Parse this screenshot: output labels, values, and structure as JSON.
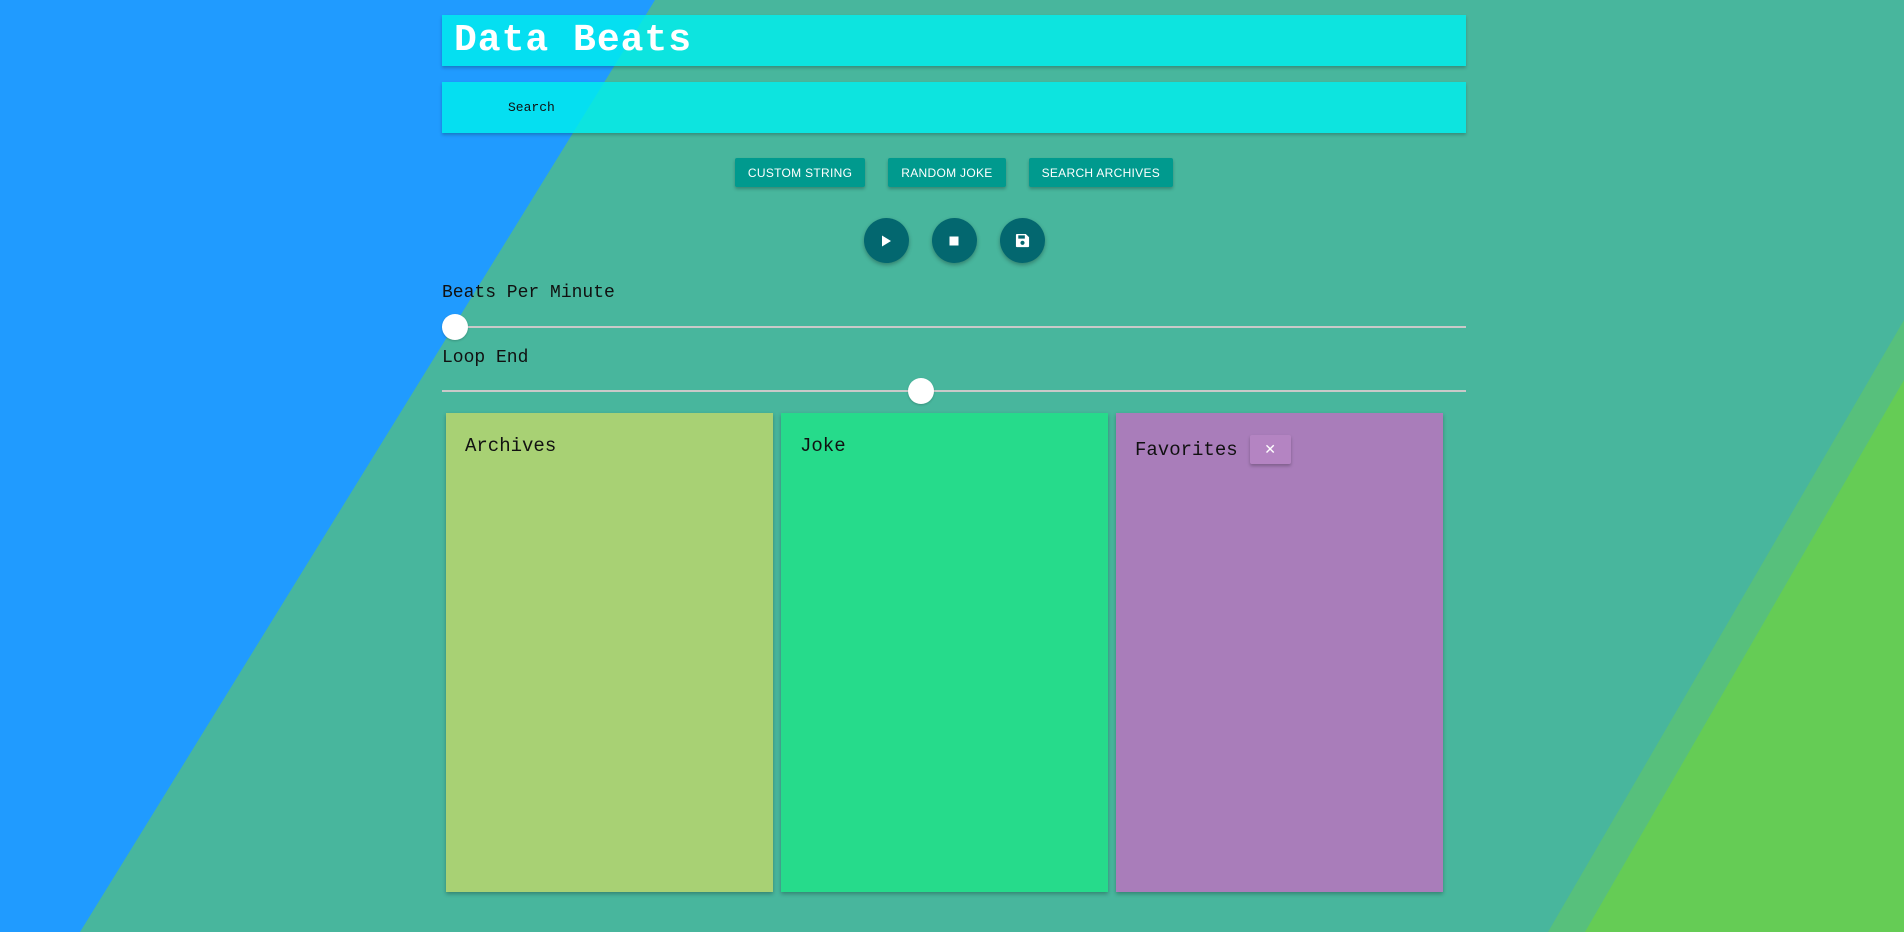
{
  "header": {
    "title": "Data Beats"
  },
  "search": {
    "placeholder": "Search",
    "value": ""
  },
  "actions": {
    "custom_string": "Custom String",
    "random_joke": "Random Joke",
    "search_archives": "Search Archives"
  },
  "transport": {
    "play_icon": "play-icon",
    "stop_icon": "stop-icon",
    "save_icon": "save-icon"
  },
  "sliders": {
    "bpm": {
      "label": "Beats Per Minute",
      "value_fraction": 0.0
    },
    "loop_end": {
      "label": "Loop End",
      "value_fraction": 0.467
    }
  },
  "panels": {
    "archives": {
      "title": "Archives",
      "color": "#a8d174"
    },
    "joke": {
      "title": "Joke",
      "color": "#26db8b"
    },
    "favorites": {
      "title": "Favorites",
      "color": "#a97dba",
      "clear_symbol": "✕"
    }
  },
  "colors": {
    "background_teal": "#48b69d",
    "background_blue": "#209bff",
    "background_green": "#65cc55",
    "accent_button": "#009a8e",
    "fab": "#03676f",
    "bar": "#1be8e0"
  }
}
